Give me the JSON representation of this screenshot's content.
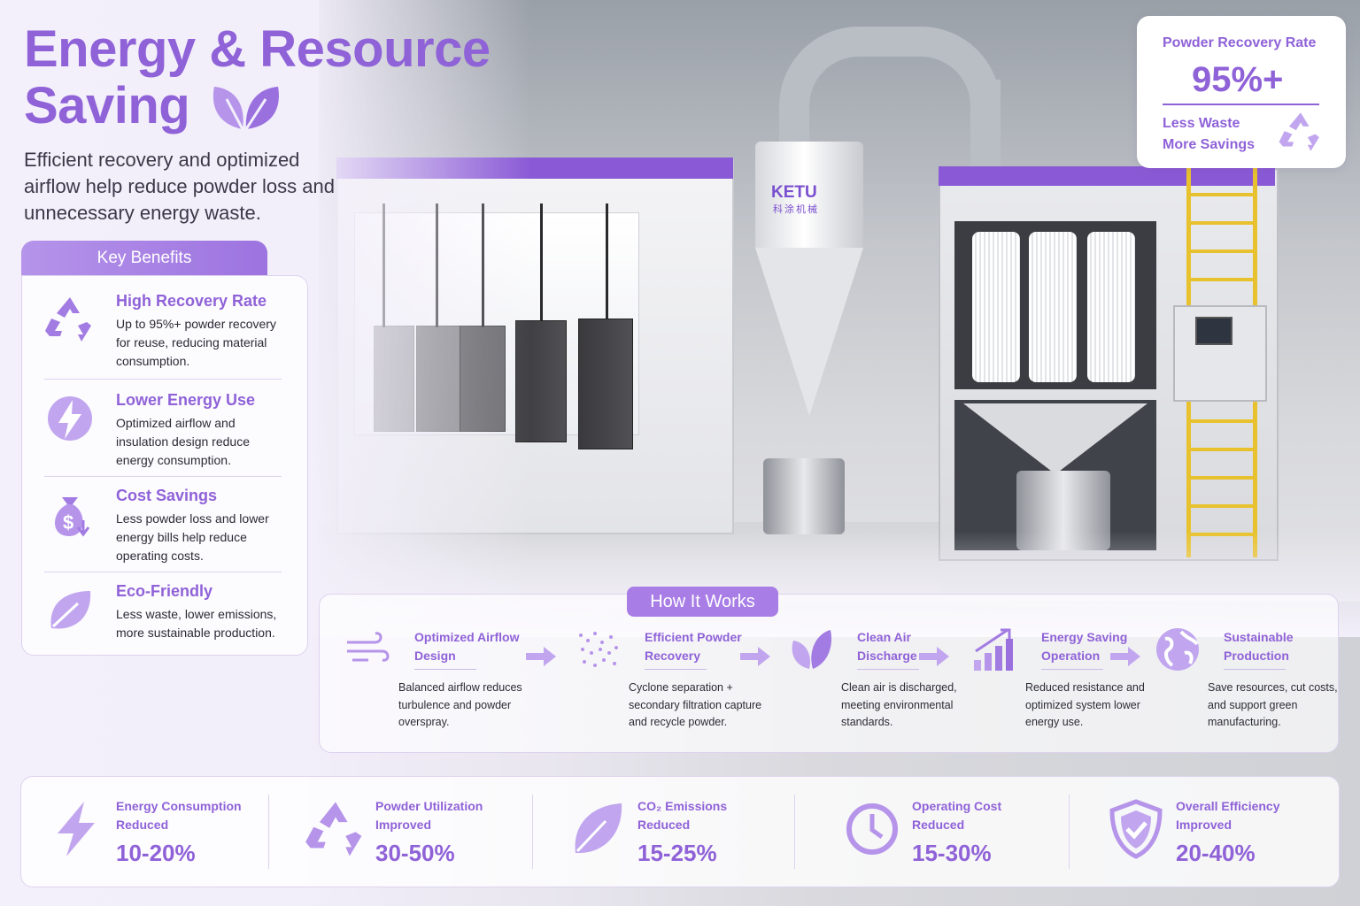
{
  "title_line1": "Energy & Resource",
  "title_line2": "Saving",
  "subtitle": "Efficient recovery and optimized airflow help reduce powder loss and unnecessary energy waste.",
  "machine_brand": "KETU",
  "machine_brand_cn": "科涂机械",
  "recovery": {
    "label": "Powder Recovery Rate",
    "value": "95%+",
    "fraction": 0.95,
    "line1": "Less Waste",
    "line2": "More Savings",
    "icon": "recycle-icon"
  },
  "key_benefits": {
    "heading": "Key Benefits",
    "items": [
      {
        "title": "High Recovery Rate",
        "text": "Up to 95%+ powder recovery for reuse, reducing material consumption.",
        "icon": "recycle-icon"
      },
      {
        "title": "Lower Energy Use",
        "text": "Optimized airflow and insulation design reduce energy consumption.",
        "icon": "energy-bolt-icon"
      },
      {
        "title": "Cost Savings",
        "text": "Less powder loss and lower energy bills help reduce operating costs.",
        "icon": "money-bag-icon"
      },
      {
        "title": "Eco-Friendly",
        "text": "Less waste, lower emissions, more sustainable production.",
        "icon": "leaf-icon"
      }
    ]
  },
  "how_it_works": {
    "heading": "How It Works",
    "steps": [
      {
        "title": "Optimized Airflow Design",
        "text": "Balanced airflow reduces turbulence and powder overspray.",
        "icon": "wind-icon"
      },
      {
        "title": "Efficient Powder Recovery",
        "text": "Cyclone separation + secondary filtration capture and recycle powder.",
        "icon": "particles-icon"
      },
      {
        "title": "Clean Air Discharge",
        "text": "Clean air is discharged, meeting environmental standards.",
        "icon": "leaves-icon"
      },
      {
        "title": "Energy Saving Operation",
        "text": "Reduced resistance and optimized system lower energy use.",
        "icon": "bar-chart-icon"
      },
      {
        "title": "Sustainable Production",
        "text": "Save resources, cut costs, and support green manufacturing.",
        "icon": "globe-icon"
      }
    ]
  },
  "stats": [
    {
      "label1": "Energy Consumption",
      "label2": "Reduced",
      "value": "10-20%",
      "icon": "bolt-icon"
    },
    {
      "label1": "Powder Utilization",
      "label2": "Improved",
      "value": "30-50%",
      "icon": "recycle-icon"
    },
    {
      "label1": "CO₂ Emissions",
      "label2": "Reduced",
      "value": "15-25%",
      "icon": "leaf-icon"
    },
    {
      "label1": "Operating Cost",
      "label2": "Reduced",
      "value": "15-30%",
      "icon": "clock-icon"
    },
    {
      "label1": "Overall Efficiency",
      "label2": "Improved",
      "value": "20-40%",
      "icon": "shield-check-icon"
    }
  ],
  "colors": {
    "accent": "#8f62d8",
    "accent_light": "#b594ea",
    "brand_stripe": "#8a5ad6"
  }
}
